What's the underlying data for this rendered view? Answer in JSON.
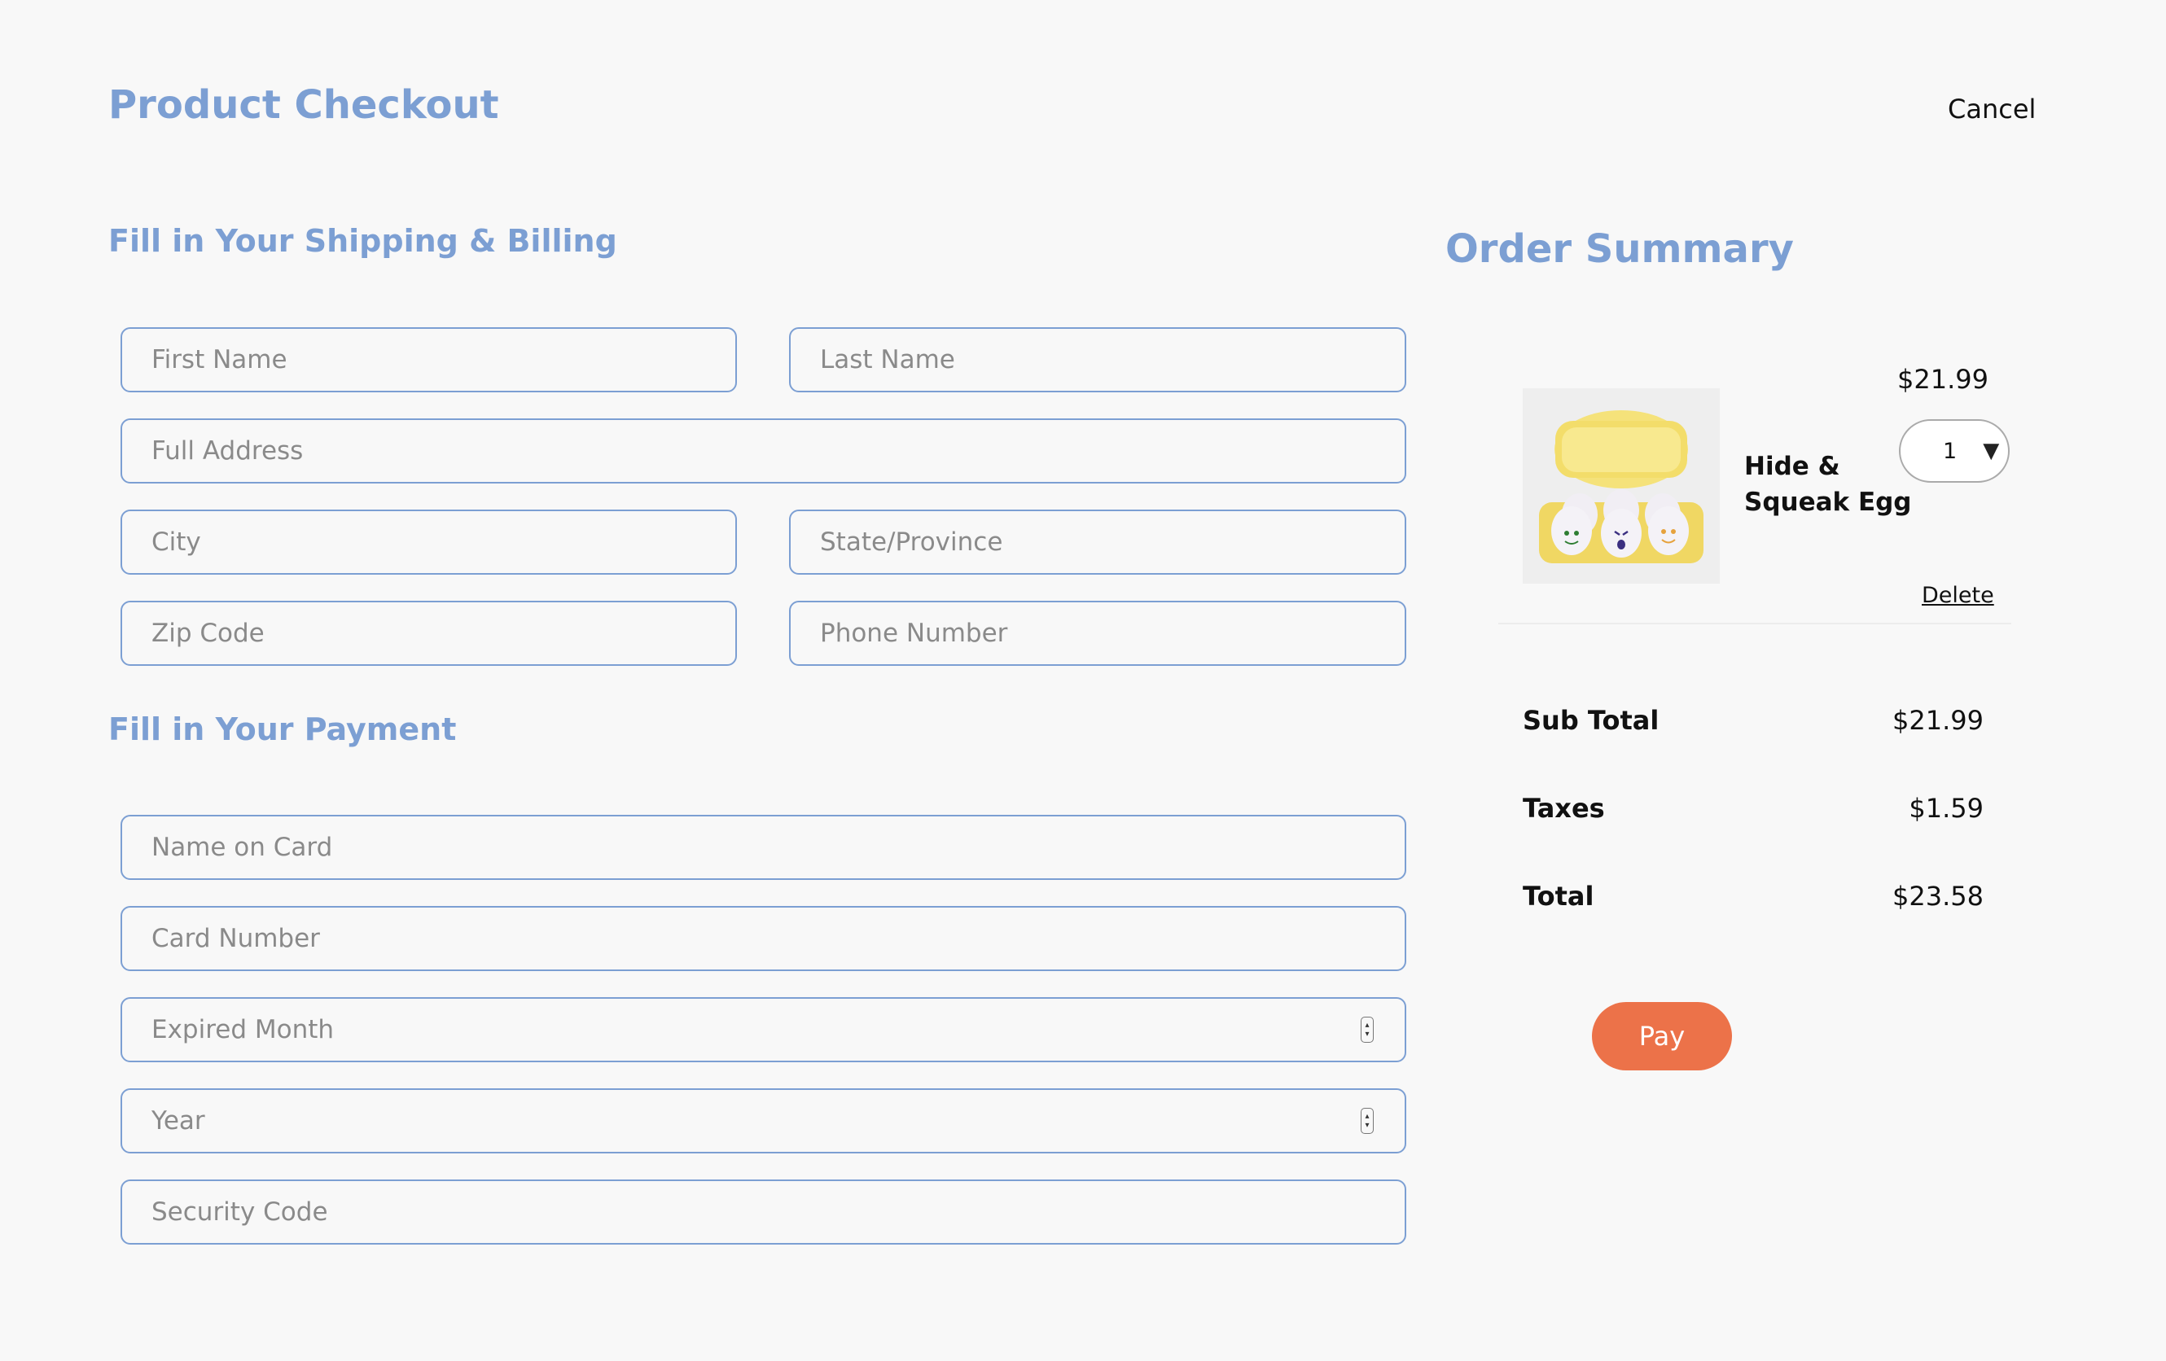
{
  "header": {
    "title": "Product Checkout",
    "cancel_label": "Cancel"
  },
  "shipping": {
    "title": "Fill in Your Shipping & Billing",
    "first_name": "First Name",
    "last_name": "Last Name",
    "full_address": "Full Address",
    "city": "City",
    "state": "State/Province",
    "zip": "Zip Code",
    "phone": "Phone Number"
  },
  "payment": {
    "title": "Fill in Your Payment",
    "name_on_card": "Name on Card",
    "card_number": "Card Number",
    "expired_month": "Expired Month",
    "year": "Year",
    "security_code": "Security Code"
  },
  "summary": {
    "title": "Order Summary",
    "item": {
      "name_line1": "Hide &",
      "name_line2": "Squeak Egg",
      "price": "$21.99",
      "quantity": "1",
      "delete_label": "Delete",
      "image_icon": "egg-carton-toy-image"
    },
    "subtotal_label": "Sub Total",
    "subtotal_value": "$21.99",
    "taxes_label": "Taxes",
    "taxes_value": "$1.59",
    "total_label": "Total",
    "total_value": "$23.58",
    "pay_label": "Pay"
  },
  "colors": {
    "accent": "#7c9fd3",
    "pay_button": "#ec7249",
    "background": "#f8f8f8"
  }
}
